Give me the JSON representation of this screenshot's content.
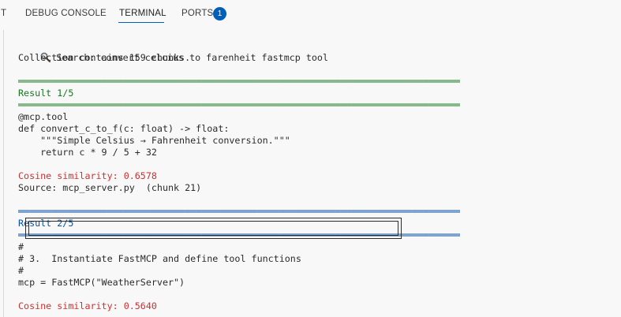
{
  "panel": {
    "tabs": [
      {
        "label": "T"
      },
      {
        "label": "DEBUG CONSOLE"
      },
      {
        "label": "TERMINAL"
      },
      {
        "label": "PORTS"
      }
    ],
    "ports_badge": "1",
    "active_tab": "TERMINAL"
  },
  "terminal": {
    "search_icon": "magnifying-glass-icon",
    "search_line": " Search: convert celcius to farenheit fastmcp tool",
    "collection_line": "Collection contains 159 chunks.",
    "rule": "════════════════════════════════════════════════════════════════════════════════════════════════════════════════",
    "result1": {
      "heading": "Result 1/5",
      "code": [
        "@mcp.tool",
        "def convert_c_to_f(c: float) -> float:",
        "    \"\"\"Simple Celsius → Fahrenheit conversion.\"\"\"",
        "    return c * 9 / 5 + 32"
      ],
      "similarity": "Cosine similarity: 0.6578",
      "source": "Source: mcp_server.py  (chunk 21)"
    },
    "result2": {
      "heading": "Result 2/5",
      "code": [
        "#",
        "# 3.  Instantiate FastMCP and define tool functions",
        "#",
        "mcp = FastMCP(\"WeatherServer\")"
      ],
      "similarity": "Cosine similarity: 0.5640"
    }
  },
  "colors": {
    "accent": "#005fb8",
    "result1_green": "#147a1e",
    "result2_blue": "#0451a5",
    "similarity_red": "#cd3131"
  }
}
